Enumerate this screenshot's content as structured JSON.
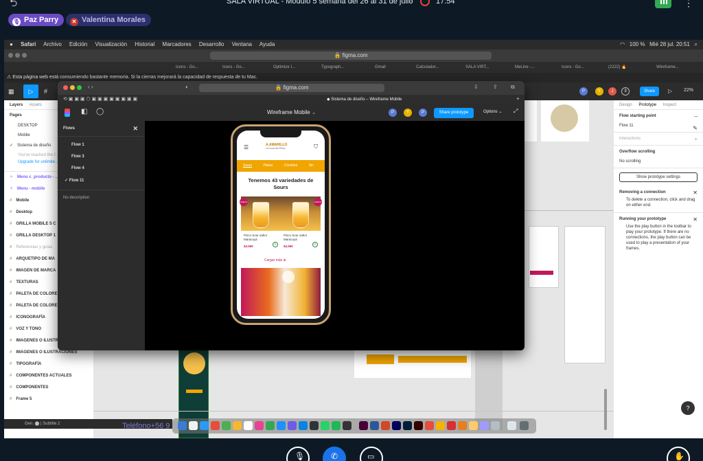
{
  "meet": {
    "title": "SALA VIRTUAL - Módulo 5 semana del 26 al 31 de julio",
    "time": "17:54",
    "participants": [
      "Paz Parry",
      "Valentina Morales"
    ],
    "bottom_text": "Teléfono+56 9",
    "colors": {
      "pill1": "#6a4bc4",
      "pill2": "#2c2f6b",
      "accent": "#1a73e8"
    }
  },
  "mac_menu": {
    "items": [
      "Safari",
      "Archivo",
      "Edición",
      "Visualización",
      "Historial",
      "Marcadores",
      "Desarrollo",
      "Ventana",
      "Ayuda"
    ],
    "status": "100 %",
    "datetime": "Mié 28 jul.  20:51"
  },
  "safari_back": {
    "url": "figma.com",
    "tabs": [
      "Icons - Go...",
      "Icons - Go...",
      "Optimize I...",
      "Typograph...",
      "Gmail",
      "Calculador...",
      "SALA VIRT...",
      "MeLine -...",
      "Icons - Go...",
      "(2222) 🔥",
      "Wireframe..."
    ],
    "notice": "Esta página web está consumiendo bastante memoria. Si la cierras mejorará la capacidad de respuesta de tu Mac."
  },
  "figma_editor": {
    "left_tabs": [
      "Layers",
      "Assets"
    ],
    "pages_header": "Pages",
    "pages": [
      "DESKTOP",
      "Mobile",
      "Sistema de diseño"
    ],
    "limit_note": "You've reached the f...",
    "upgrade": "Upgrade for unlimite...",
    "layers": [
      "Menu c_producto - ...",
      "Menu - mobile",
      "Mobile",
      "Desktop",
      "GRILLA MOBILE 5 C",
      "GRILLA DESKTOP 1",
      "Referencias y guías",
      "ARQUETIPO DE MA",
      "IMAGEN DE MARCA",
      "TEXTURAS",
      "PALETA DE COLORE",
      "PALETA DE COLORE",
      "ICONOGRAFÍA",
      "VOZ Y TONO",
      "IMAGENES O ILUSTRACIONES",
      "IMAGENES O ILUSTRACIONES",
      "TIPOGRAFÍA",
      "COMPONENTES ACTUALES",
      "COMPONENTES",
      "Frame 5"
    ],
    "share_label": "Share",
    "zoom": "22%",
    "right_tabs": [
      "Design",
      "Prototype",
      "Inspect"
    ],
    "flow_starting_point": "Flow starting point",
    "flow_value": "Flow 11",
    "interactions": "Interactions",
    "overflow": "Overflow scrolling",
    "overflow_value": "No scrolling",
    "show_settings": "Show prototype settings",
    "removing_title": "Removing a connection",
    "removing_desc": "To delete a connection, click and drag on either end.",
    "running_title": "Running your prototype",
    "running_desc": "Use the play button in the toolbar to play your prototype. If there are no connections, the play button can be used to play a presentation of your frames.",
    "help": "?",
    "bottom_status": "Gen. ⬤ | Subtitle 2"
  },
  "prototype": {
    "url": "figma.com",
    "tab": "Sistema de diseño – Wireframe Mobile",
    "file_name": "Wireframe Mobile",
    "share_btn": "Share prototype",
    "options": "Options",
    "flows_header": "Flows",
    "flows": [
      "Flow 1",
      "Flow 3",
      "Flow 4",
      "Flow 11"
    ],
    "selected_flow": "Flow 11",
    "no_description": "No description",
    "avatars": [
      {
        "letter": "P",
        "color": "#5b7bd5"
      },
      {
        "letter": "Y",
        "color": "#e8b400"
      },
      {
        "letter": "P",
        "color": "#5b7bd5"
      }
    ]
  },
  "phone": {
    "brand": "A.AMARILLO",
    "brand_sub": "La Cuna del Pisco",
    "categories": [
      "Sours",
      "Platos",
      "Cócteles",
      "Sin"
    ],
    "heading": "Tenemos 43 variedades de Sours",
    "products": [
      {
        "name": "Pisco Sour sabor Maracuyá",
        "price": "$4.590",
        "badge": "NUEVO"
      },
      {
        "name": "Pisco Sour sabor Maracuyá",
        "price": "$4.590",
        "badge": "NUEVO"
      }
    ],
    "load_more": "Cargar más"
  }
}
